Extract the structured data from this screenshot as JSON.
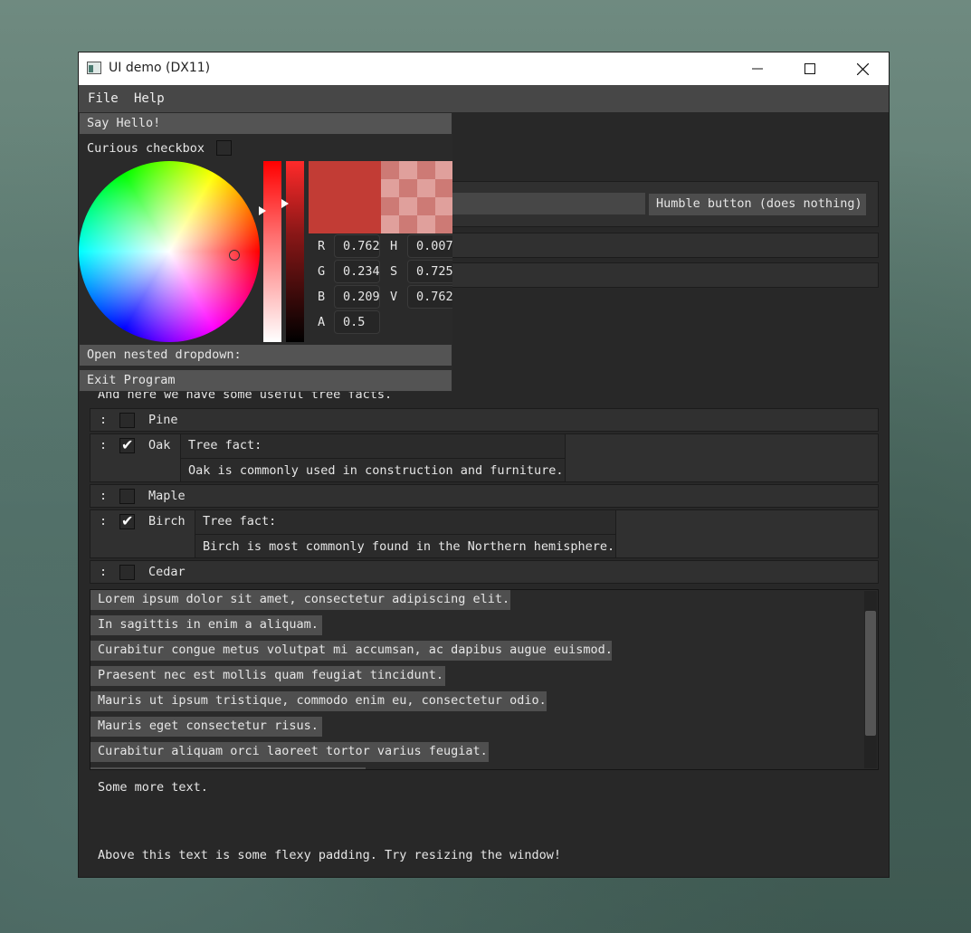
{
  "window": {
    "title": "UI demo (DX11)"
  },
  "menu": {
    "file": "File",
    "help": "Help"
  },
  "popup": {
    "say_hello": "Say Hello!",
    "curious_checkbox": "Curious checkbox",
    "curious_checked": false,
    "nested_dropdown": "Open nested dropdown:",
    "exit_program": "Exit Program",
    "color": {
      "hex": "#c23c35",
      "r_label": "R",
      "r": "0.7624",
      "g_label": "G",
      "g": "0.2345",
      "b_label": "B",
      "b": "0.2096",
      "a_label": "A",
      "a": "0.5",
      "h_label": "H",
      "h": "0.0076",
      "s_label": "S",
      "s": "0.7254",
      "v_label": "V",
      "v": "0.7624"
    }
  },
  "main": {
    "humble_button": "Humble button (does nothing)",
    "tree_intro": "And here we have some useful tree facts.",
    "trees": [
      {
        "handle": ":",
        "name": "Pine",
        "checked": false
      },
      {
        "handle": ":",
        "name": "Oak",
        "checked": true,
        "fact_title": "Tree fact:",
        "fact": "Oak is commonly used in construction and furniture."
      },
      {
        "handle": ":",
        "name": "Maple",
        "checked": false
      },
      {
        "handle": ":",
        "name": "Birch",
        "checked": true,
        "fact_title": "Tree fact:",
        "fact": "Birch is most commonly found in the Northern hemisphere."
      },
      {
        "handle": ":",
        "name": "Cedar",
        "checked": false
      }
    ],
    "lorem_items": [
      "Lorem ipsum dolor sit amet, consectetur adipiscing elit.",
      "In sagittis in enim a aliquam.",
      "Curabitur congue metus volutpat mi accumsan, ac dapibus augue euismod.",
      "Praesent nec est mollis quam feugiat tincidunt.",
      "Mauris ut ipsum tristique, commodo enim eu, consectetur odio.",
      "Mauris eget consectetur risus.",
      "Curabitur aliquam orci laoreet tortor varius feugiat."
    ],
    "some_more_text": "Some more text.",
    "flexy_text": "Above this text is some flexy padding. Try resizing the window!"
  }
}
